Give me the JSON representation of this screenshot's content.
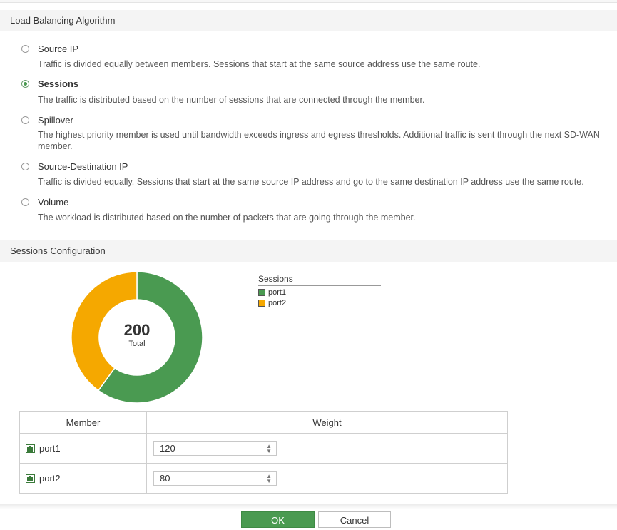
{
  "lb_section": {
    "title": "Load Balancing Algorithm",
    "options": [
      {
        "label": "Source IP",
        "desc": "Traffic is divided equally between members. Sessions that start at the same source address use the same route.",
        "selected": false
      },
      {
        "label": "Sessions",
        "desc": "The traffic is distributed based on the number of sessions that are connected through the member.",
        "selected": true
      },
      {
        "label": "Spillover",
        "desc": "The highest priority member is used until bandwidth exceeds ingress and egress thresholds. Additional traffic is sent through the next SD-WAN member.",
        "selected": false
      },
      {
        "label": "Source-Destination IP",
        "desc": "Traffic is divided equally. Sessions that start at the same source IP address and go to the same destination IP address use the same route.",
        "selected": false
      },
      {
        "label": "Volume",
        "desc": "The workload is distributed based on the number of packets that are going through the member.",
        "selected": false
      }
    ]
  },
  "sessions_section": {
    "title": "Sessions Configuration",
    "total_value": "200",
    "total_label": "Total",
    "legend_title": "Sessions"
  },
  "chart_data": {
    "type": "pie",
    "donut": true,
    "title": "",
    "legend_title": "Sessions",
    "legend_position": "right",
    "center_value": 200,
    "center_label": "Total",
    "series": [
      {
        "name": "port1",
        "value": 120,
        "color": "#4a9a51"
      },
      {
        "name": "port2",
        "value": 80,
        "color": "#f5a800"
      }
    ]
  },
  "table": {
    "headers": {
      "member": "Member",
      "weight": "Weight"
    },
    "rows": [
      {
        "member": "port1",
        "weight": "120"
      },
      {
        "member": "port2",
        "weight": "80"
      }
    ]
  },
  "buttons": {
    "ok": "OK",
    "cancel": "Cancel"
  },
  "colors": {
    "accent": "#4a9a51",
    "port1": "#4a9a51",
    "port2": "#f5a800"
  },
  "icons": {
    "selected_radio": "radio-checked",
    "port": "network-port-icon",
    "stepper": "up-down-stepper-icon"
  }
}
